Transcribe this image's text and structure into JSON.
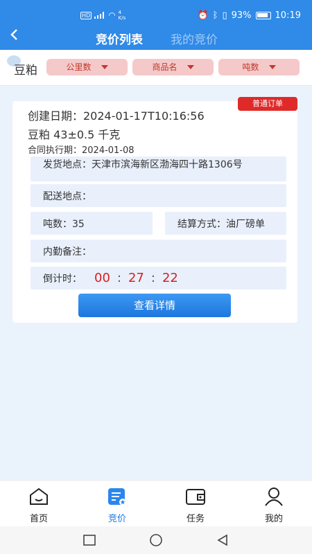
{
  "status": {
    "net_speed": "4\nK/s",
    "battery": "93%",
    "time": "10:19"
  },
  "nav": {
    "back_icon": "chevron-left-icon",
    "tabs": [
      {
        "label": "竞价列表",
        "active": true
      },
      {
        "label": "我的竞价",
        "active": false
      }
    ]
  },
  "filters": {
    "category": "豆粕",
    "buttons": [
      {
        "label": "公里数"
      },
      {
        "label": "商品名"
      },
      {
        "label": "吨数"
      }
    ]
  },
  "order": {
    "badge": "普通订单",
    "created": "创建日期：2024-01-17T10:16:56",
    "product": "豆粕 43±0.5 千克",
    "contract": "合同执行期：2024-01-08",
    "ship_from": "发货地点：天津市滨海新区渤海四十路1306号",
    "deliver_to": "配送地点：",
    "tonnage": "吨数：35",
    "settlement": "结算方式：油厂磅单",
    "remarks": "内勤备注：",
    "countdown_label": "倒计时：",
    "countdown": {
      "h": "00",
      "m": "27",
      "s": "22",
      "sep": ":"
    },
    "detail_button": "查看详情"
  },
  "bottom_nav": [
    {
      "label": "首页",
      "icon": "home-icon"
    },
    {
      "label": "竞价",
      "icon": "bid-list-icon",
      "active": true
    },
    {
      "label": "任务",
      "icon": "wallet-icon"
    },
    {
      "label": "我的",
      "icon": "user-icon"
    }
  ],
  "colors": {
    "primary": "#2f8ae8",
    "badge": "#e02a2a",
    "countdown": "#d42020"
  }
}
